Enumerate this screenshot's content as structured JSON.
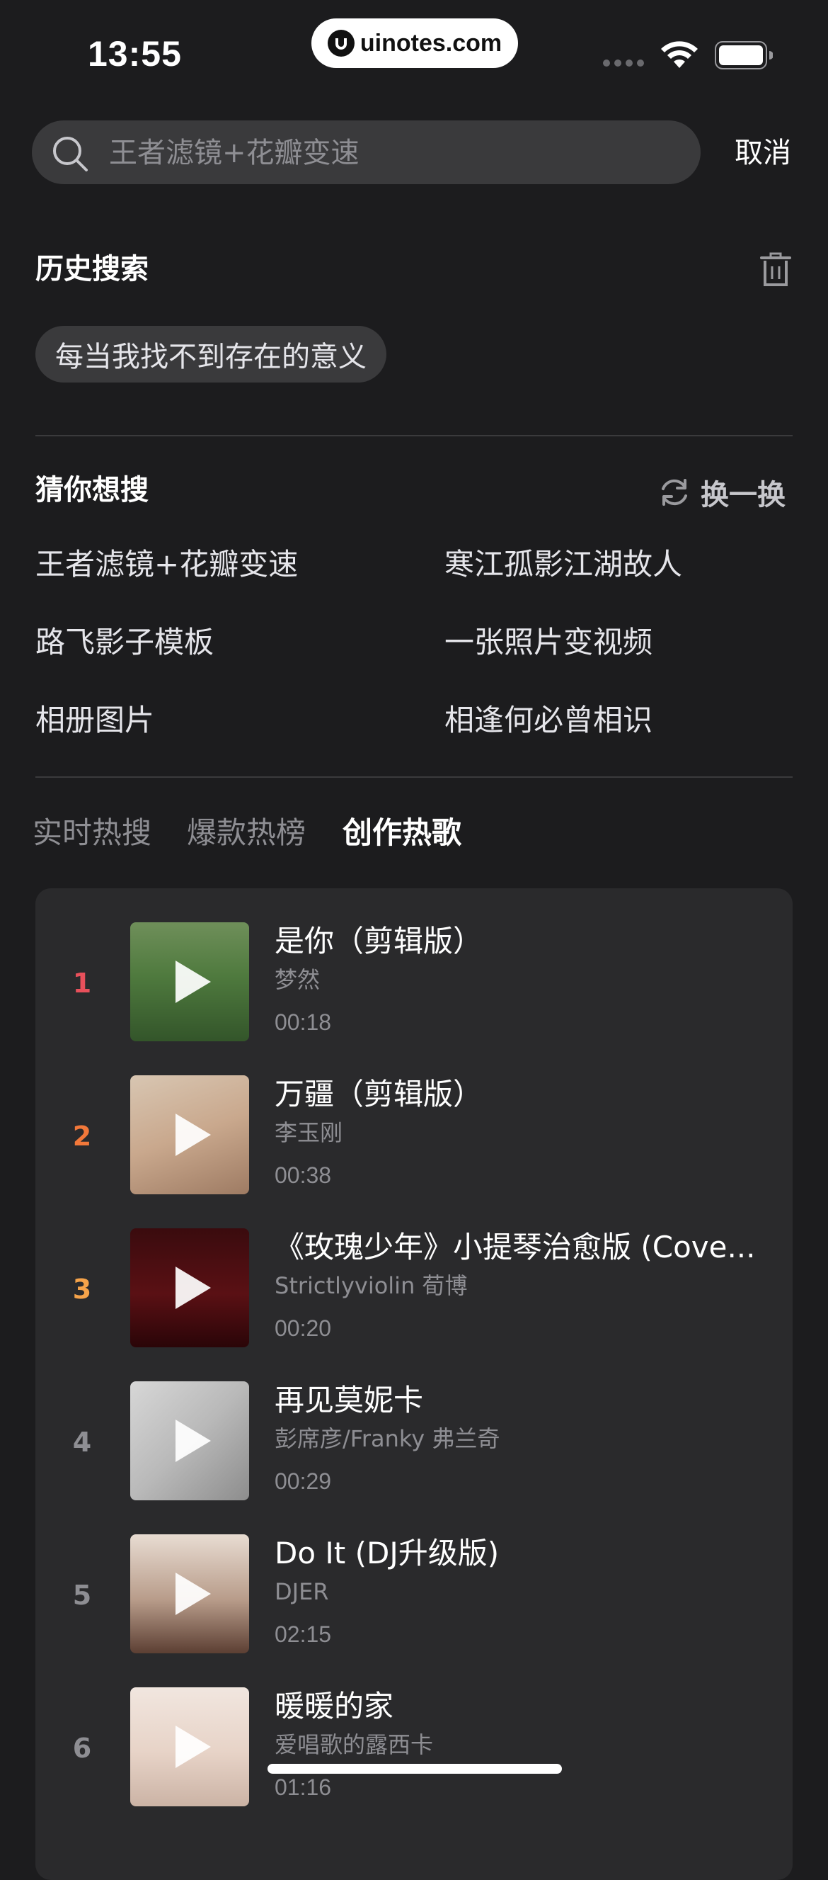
{
  "status_bar": {
    "time": "13:55",
    "watermark": "uinotes.com"
  },
  "search": {
    "placeholder": "王者滤镜+花瓣变速",
    "cancel_label": "取消"
  },
  "history": {
    "title": "历史搜索",
    "items": [
      "每当我找不到存在的意义"
    ]
  },
  "suggestions": {
    "title": "猜你想搜",
    "refresh_label": "换一换",
    "items": [
      "王者滤镜+花瓣变速",
      "寒江孤影江湖故人",
      "路飞影子模板",
      "一张照片变视频",
      "相册图片",
      "相逢何必曾相识"
    ]
  },
  "tabs": {
    "items": [
      "实时热搜",
      "爆款热榜",
      "创作热歌"
    ],
    "active_index": 2
  },
  "songs": [
    {
      "rank": "1",
      "title": "是你（剪辑版）",
      "artist": "梦然",
      "duration": "00:18",
      "rank_color": "#e8505b"
    },
    {
      "rank": "2",
      "title": "万疆（剪辑版）",
      "artist": "李玉刚",
      "duration": "00:38",
      "rank_color": "#f2783a"
    },
    {
      "rank": "3",
      "title": "《玫瑰少年》小提琴治愈版 (Cove...",
      "artist": "Strictlyviolin 荀博",
      "duration": "00:20",
      "rank_color": "#f5a34a"
    },
    {
      "rank": "4",
      "title": "再见莫妮卡",
      "artist": "彭席彦/Franky 弗兰奇",
      "duration": "00:29",
      "rank_color": "#8e8e93"
    },
    {
      "rank": "5",
      "title": "Do It (DJ升级版)",
      "artist": "DJER",
      "duration": "02:15",
      "rank_color": "#8e8e93"
    },
    {
      "rank": "6",
      "title": "暖暖的家",
      "artist": "爱唱歌的露西卡",
      "duration": "01:16",
      "rank_color": "#8e8e93"
    }
  ]
}
